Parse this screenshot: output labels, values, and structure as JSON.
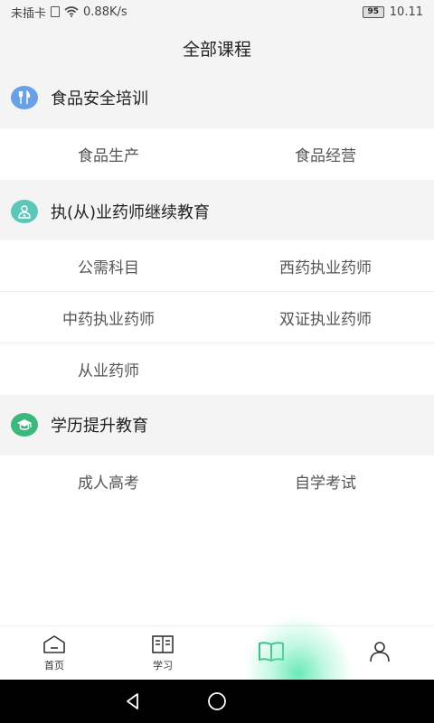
{
  "status_bar": {
    "carrier": "未插卡",
    "speed": "0.88K/s",
    "battery": "95",
    "time": "10.11"
  },
  "header": {
    "title": "全部课程"
  },
  "sections": [
    {
      "title": "食品安全培训",
      "icon": "fork-knife-icon",
      "icon_color": "#6aa0e6",
      "items": [
        "食品生产",
        "食品经营"
      ]
    },
    {
      "title": "执(从)业药师继续教育",
      "icon": "pharmacist-icon",
      "icon_color": "#5cc6b8",
      "items": [
        "公需科目",
        "西药执业药师",
        "中药执业药师",
        "双证执业药师",
        "从业药师"
      ]
    },
    {
      "title": "学历提升教育",
      "icon": "graduation-cap-icon",
      "icon_color": "#3bb87a",
      "items": [
        "成人高考",
        "自学考试"
      ]
    }
  ],
  "bottom_nav": [
    {
      "label": "首页",
      "icon": "home-icon"
    },
    {
      "label": "学习",
      "icon": "study-book-icon"
    },
    {
      "label": "",
      "icon": "courses-book-icon",
      "active": true,
      "accent": "#2fb67c"
    },
    {
      "label": "",
      "icon": "profile-icon"
    }
  ]
}
